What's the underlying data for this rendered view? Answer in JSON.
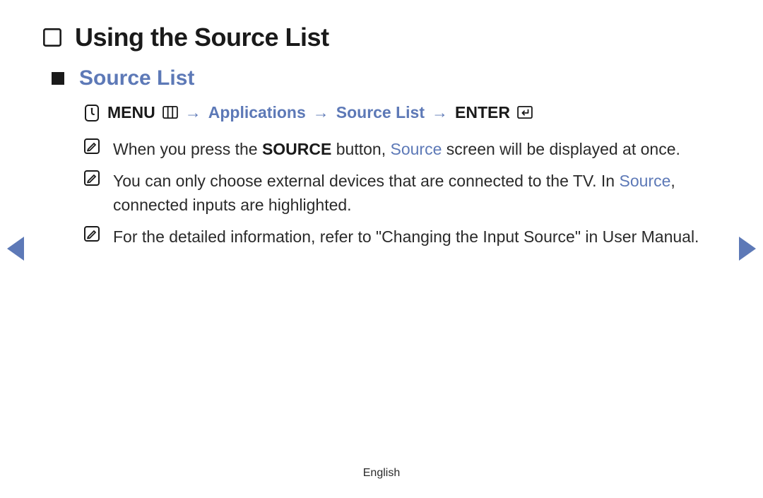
{
  "title": "Using the Source List",
  "section": "Source List",
  "footer_language": "English",
  "breadcrumb": {
    "menu": "MENU",
    "applications": "Applications",
    "source_list": "Source List",
    "enter": "ENTER",
    "arrow": "→"
  },
  "notes": [
    {
      "pre1": "When you press the ",
      "bold1": "SOURCE",
      "mid1": " button, ",
      "accent1": "Source",
      "post1": " screen will be displayed at once."
    },
    {
      "pre1": "You can only choose external devices that are connected to the TV. In ",
      "accent1": "Source",
      "post1": ", connected inputs are highlighted."
    },
    {
      "pre1": "For the detailed information, refer to \"Changing the Input Source\" in User Manual."
    }
  ]
}
